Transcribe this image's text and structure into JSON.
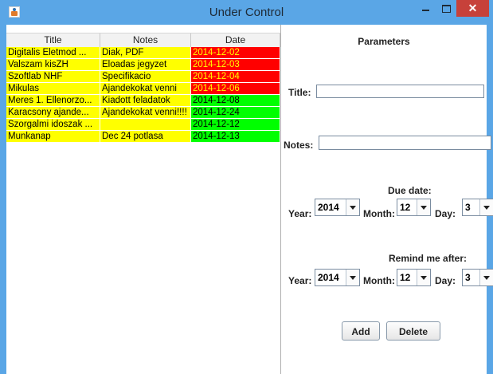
{
  "window": {
    "title": "Under Control",
    "close_glyph": "✕"
  },
  "table": {
    "columns": [
      "Title",
      "Notes",
      "Date"
    ],
    "rows": [
      {
        "title": "Digitalis Eletmod ...",
        "notes": "Diak, PDF",
        "date": "2014-12-02",
        "status": "red"
      },
      {
        "title": "Valszam kisZH",
        "notes": "Eloadas jegyzet",
        "date": "2014-12-03",
        "status": "red"
      },
      {
        "title": "Szoftlab NHF",
        "notes": "Specifikacio",
        "date": "2014-12-04",
        "status": "red"
      },
      {
        "title": "Mikulas",
        "notes": "Ajandekokat venni",
        "date": "2014-12-06",
        "status": "red"
      },
      {
        "title": "Meres 1. Ellenorzo...",
        "notes": "Kiadott feladatok",
        "date": "2014-12-08",
        "status": "green"
      },
      {
        "title": "Karacsony ajande...",
        "notes": "Ajandekokat venni!!!!",
        "date": "2014-12-24",
        "status": "green"
      },
      {
        "title": "Szorgalmi idoszak ...",
        "notes": "",
        "date": "2014-12-12",
        "status": "green"
      },
      {
        "title": "Munkanap",
        "notes": "Dec 24 potlasa",
        "date": "2014-12-13",
        "status": "green"
      }
    ]
  },
  "params": {
    "heading": "Parameters",
    "title_label": "Title:",
    "title_value": "",
    "notes_label": "Notes:",
    "notes_value": "",
    "due_heading": "Due date:",
    "remind_heading": "Remind me after:",
    "year_label": "Year:",
    "month_label": "Month:",
    "day_label": "Day:",
    "due": {
      "year": "2014",
      "month": "12",
      "day": "3"
    },
    "remind": {
      "year": "2014",
      "month": "12",
      "day": "3"
    },
    "add_label": "Add",
    "delete_label": "Delete"
  },
  "colors": {
    "titlebar": "#5aa6e6",
    "row_title_notes": "#ffff00",
    "date_overdue": "#ff0000",
    "date_overdue_text": "#ffff00",
    "date_upcoming": "#00ff00",
    "close_button": "#c7413a"
  }
}
